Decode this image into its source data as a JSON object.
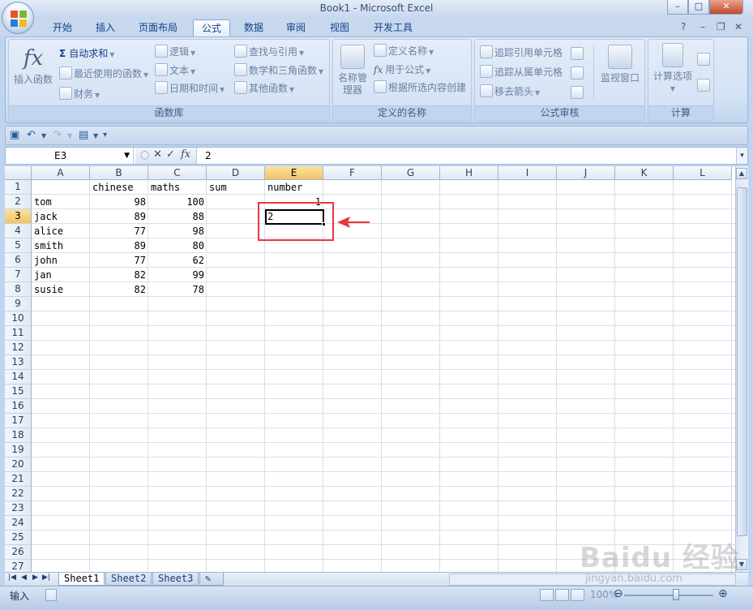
{
  "window": {
    "title": "Book1 - Microsoft Excel",
    "minimize": "–",
    "maximize": "□",
    "close": "✕"
  },
  "ribbon_tabs": [
    "开始",
    "插入",
    "页面布局",
    "公式",
    "数据",
    "审阅",
    "视图",
    "开发工具"
  ],
  "active_tab": "公式",
  "help_controls": {
    "help": "?",
    "min": "–",
    "restore": "❐",
    "close": "✕"
  },
  "groups": {
    "function_library": {
      "label": "函数库",
      "insert_function": "插入函数",
      "autosum": "自动求和",
      "recent": "最近使用的函数",
      "financial": "财务",
      "logical": "逻辑",
      "text": "文本",
      "datetime": "日期和时间",
      "lookup": "查找与引用",
      "math": "数学和三角函数",
      "other": "其他函数"
    },
    "defined_names": {
      "label": "定义的名称",
      "name_manager": "名称管理器",
      "define_name": "定义名称",
      "use_in_formula": "用于公式",
      "create_from_selection": "根据所选内容创建"
    },
    "formula_auditing": {
      "label": "公式审核",
      "trace_precedents": "追踪引用单元格",
      "trace_dependents": "追踪从属单元格",
      "remove_arrows": "移去箭头",
      "watch_window": "监视窗口"
    },
    "calculation": {
      "label": "计算",
      "calc_options": "计算选项"
    }
  },
  "formula_bar": {
    "name_box": "E3",
    "fx": "fx",
    "cancel": "✕",
    "enter": "✓",
    "content": "2"
  },
  "columns": [
    "A",
    "B",
    "C",
    "D",
    "E",
    "F",
    "G",
    "H",
    "I",
    "J",
    "K",
    "L"
  ],
  "rows": [
    "1",
    "2",
    "3",
    "4",
    "5",
    "6",
    "7",
    "8",
    "9",
    "10",
    "11",
    "12",
    "13",
    "14",
    "15",
    "16",
    "17",
    "18",
    "19",
    "20",
    "21",
    "22",
    "23",
    "24",
    "25",
    "26",
    "27"
  ],
  "cells": {
    "B1": "chinese",
    "C1": "maths",
    "D1": "sum",
    "E1": "number",
    "A2": "tom",
    "B2": "98",
    "C2": "100",
    "E2": "1",
    "A3": "jack",
    "B3": "89",
    "C3": "88",
    "E3": "2",
    "A4": "alice",
    "B4": "77",
    "C4": "98",
    "A5": "smith",
    "B5": "89",
    "C5": "80",
    "A6": "john",
    "B6": "77",
    "C6": "62",
    "A7": "jan",
    "B7": "82",
    "C7": "99",
    "A8": "susie",
    "B8": "82",
    "C8": "78"
  },
  "sheet_tabs": [
    "Sheet1",
    "Sheet2",
    "Sheet3"
  ],
  "active_sheet": "Sheet1",
  "status": {
    "mode": "输入",
    "zoom": "100%"
  },
  "watermark": {
    "brand": "Baidu 经验",
    "url": "jingyan.baidu.com"
  },
  "colors": {
    "accent": "#15428b",
    "highlight_red": "#e8383a",
    "selected_header": "#f3c45f"
  }
}
